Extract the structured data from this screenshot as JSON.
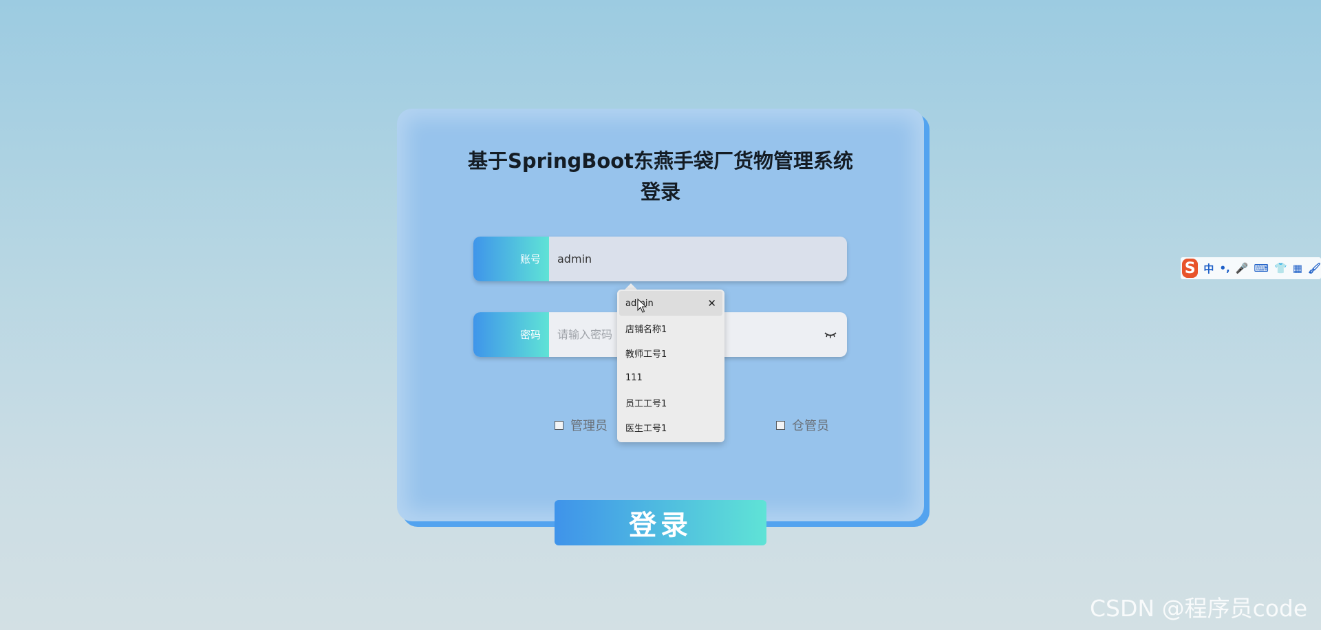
{
  "login": {
    "title": "基于SpringBoot东燕手袋厂货物管理系统登录",
    "account_label": "账号",
    "account_value": "admin",
    "password_label": "密码",
    "password_placeholder": "请输入密码",
    "login_button": "登录",
    "roles": [
      "管理员",
      "仓管员"
    ]
  },
  "autocomplete": {
    "items": [
      "admin",
      "店铺名称1",
      "教师工号1",
      "111",
      "员工工号1",
      "医生工号1"
    ],
    "close_symbol": "✕"
  },
  "ime_toolbar": {
    "logo": "S",
    "glyphs": [
      "中",
      "•,",
      "🎤",
      "⌨",
      "👕",
      "▦",
      "🖌"
    ]
  },
  "watermark": "CSDN @程序员code",
  "colors": {
    "accent_start": "#3f95ea",
    "accent_end": "#5fe3d6",
    "card": "#97c3ec",
    "card_shadow": "#53a3ef"
  }
}
